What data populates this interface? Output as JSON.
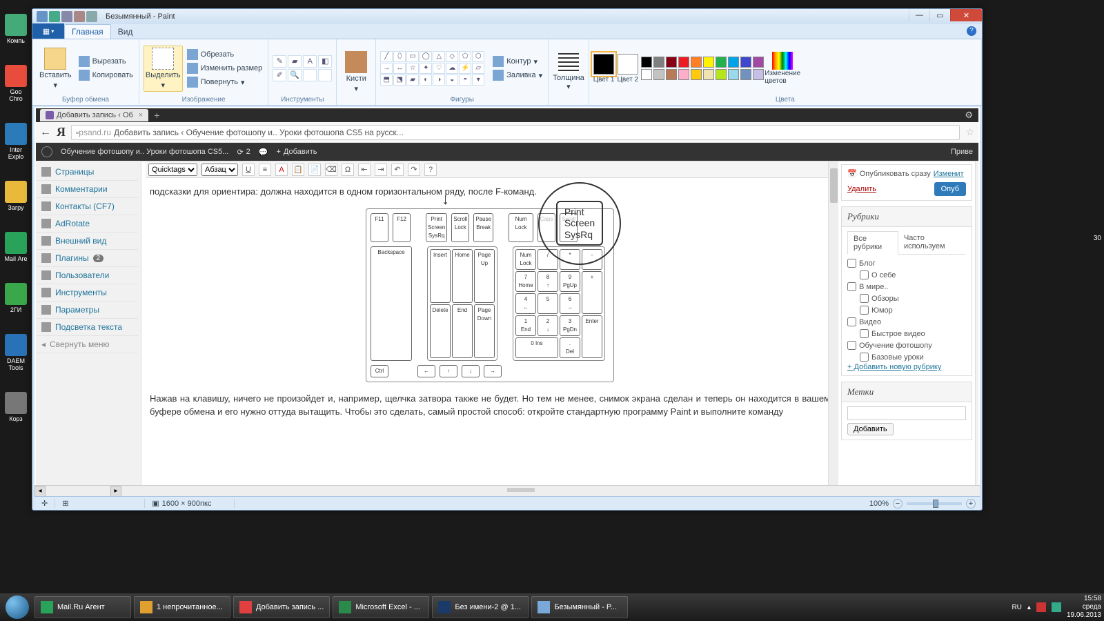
{
  "desktop": {
    "icons": [
      "Компь",
      "Goo Chro",
      "Inter Explo",
      "Загру",
      "Mail Аге",
      "2ГИ",
      "DAEM Tools",
      "Корз"
    ]
  },
  "paint": {
    "title": "Безымянный - Paint",
    "tabs": {
      "file": "",
      "main": "Главная",
      "view": "Вид"
    },
    "groups": {
      "clipboard": {
        "label": "Буфер обмена",
        "paste": "Вставить",
        "cut": "Вырезать",
        "copy": "Копировать"
      },
      "image": {
        "label": "Изображение",
        "select": "Выделить",
        "crop": "Обрезать",
        "resize": "Изменить размер",
        "rotate": "Повернуть"
      },
      "tools": {
        "label": "Инструменты"
      },
      "brushes": {
        "label": "Кисти",
        "btn": "Кисти"
      },
      "shapes": {
        "label": "Фигуры",
        "outline": "Контур",
        "fill": "Заливка"
      },
      "thickness": {
        "label": "Толщина"
      },
      "colors": {
        "label": "Цвета",
        "c1": "Цвет 1",
        "c2": "Цвет 2",
        "edit": "Изменение цветов"
      },
      "palette": [
        "#000000",
        "#7f7f7f",
        "#880015",
        "#ed1c24",
        "#ff7f27",
        "#fff200",
        "#22b14c",
        "#00a2e8",
        "#3f48cc",
        "#a349a4",
        "#ffffff",
        "#c3c3c3",
        "#b97a57",
        "#ffaec9",
        "#ffc90e",
        "#efe4b0",
        "#b5e61d",
        "#99d9ea",
        "#7092be",
        "#c8bfe7"
      ]
    },
    "status": {
      "dims": "1600 × 900пкс",
      "zoom": "100%"
    }
  },
  "browser": {
    "tab_title": "Добавить запись ‹ Об",
    "url_domain": "psand.ru",
    "url_rest": "Добавить запись ‹ Обучение фотошопу и.. Уроки фотошопа CS5 на русск..."
  },
  "wp": {
    "adminbar": {
      "site": "Обучение фотошопу и.. Уроки фотошопа CS5...",
      "refresh": "2",
      "add": "Добавить",
      "hello": "Приве"
    },
    "sidebar": [
      "Страницы",
      "Комментарии",
      "Контакты (CF7)",
      "AdRotate",
      "Внешний вид",
      "Плагины",
      "Пользователи",
      "Инструменты",
      "Параметры",
      "Подсветка текста"
    ],
    "sidebar_badge": "2",
    "collapse": "Свернуть меню",
    "editor": {
      "format_sel": "Quicktags",
      "block_sel": "Абзац",
      "para1": "подсказки для ориентира: должна находится в одном горизонтальном ряду, после F-команд.",
      "para2": "Нажав на клавишу, ничего не произойдет и, например, щелчка затвора также не будет. Но тем не менее, снимок экрана сделан и теперь он находится в вашем буфере обмена и его нужно оттуда вытащить. Чтобы это сделать, самый простой способ: откройте стандартную программу Paint и выполните команду",
      "bigkey_l1": "Print",
      "bigkey_l2": "Screen",
      "bigkey_l3": "SysRq"
    },
    "publish": {
      "immediate": "Опубликовать сразу",
      "edit": "Изменит",
      "delete": "Удалить",
      "button": "Опуб"
    },
    "rubrics": {
      "title": "Рубрики",
      "tab_all": "Все рубрики",
      "tab_freq": "Часто используем",
      "items": [
        "Блог",
        "О себе",
        "В мире..",
        "Обзоры",
        "Юмор",
        "Видео",
        "Быстрое видео",
        "Обучение фотошопу",
        "Базовые уроки"
      ],
      "add": "+ Добавить новую рубрику"
    },
    "tags": {
      "title": "Метки",
      "add": "Добавить"
    }
  },
  "taskbar": {
    "items": [
      "Mail.Ru Агент",
      "1 непрочитанное...",
      "Добавить запись ...",
      "Microsoft Excel - ...",
      "Без имени-2 @ 1...",
      "Безымянный - P..."
    ],
    "lang": "RU",
    "time": "15:58",
    "day": "среда",
    "date": "19.06.2013"
  },
  "rclock": "30"
}
